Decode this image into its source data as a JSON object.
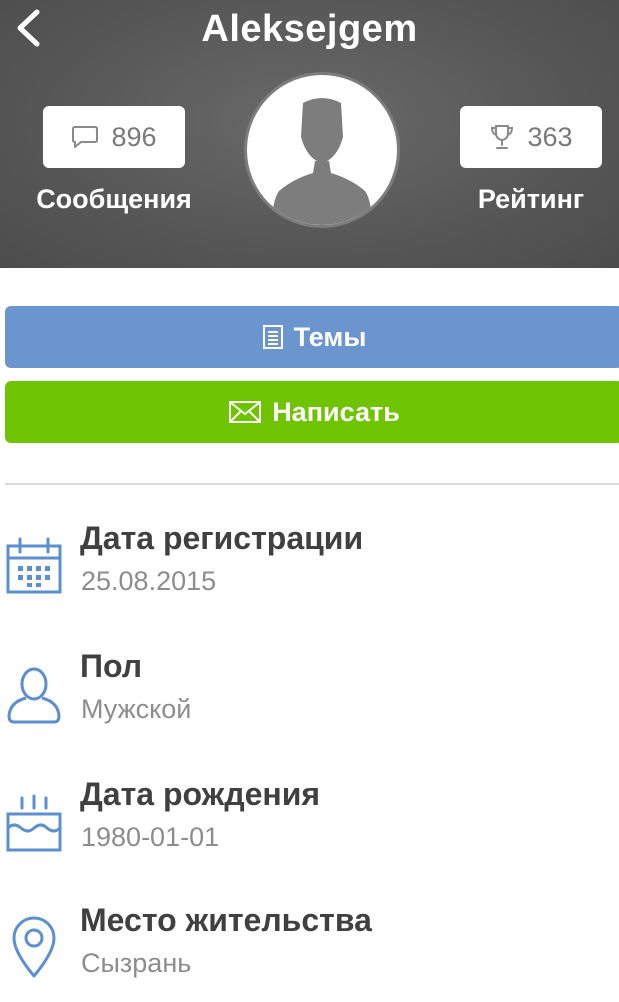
{
  "header": {
    "title": "Aleksejgem",
    "messages": {
      "count": "896",
      "label": "Сообщения"
    },
    "rating": {
      "count": "363",
      "label": "Рейтинг"
    }
  },
  "actions": {
    "topics_label": "Темы",
    "write_label": "Написать"
  },
  "info": [
    {
      "label": "Дата регистрации",
      "value": "25.08.2015",
      "icon": "calendar-icon"
    },
    {
      "label": "Пол",
      "value": "Мужской",
      "icon": "person-icon"
    },
    {
      "label": "Дата рождения",
      "value": "1980-01-01",
      "icon": "birthday-cake-icon"
    },
    {
      "label": "Место жительства",
      "value": "Сызрань",
      "icon": "location-pin-icon"
    }
  ],
  "colors": {
    "header_bg": "#585858",
    "topics_button": "#6a95cf",
    "write_button": "#6fc400",
    "icon_blue": "#5b8fcf"
  }
}
